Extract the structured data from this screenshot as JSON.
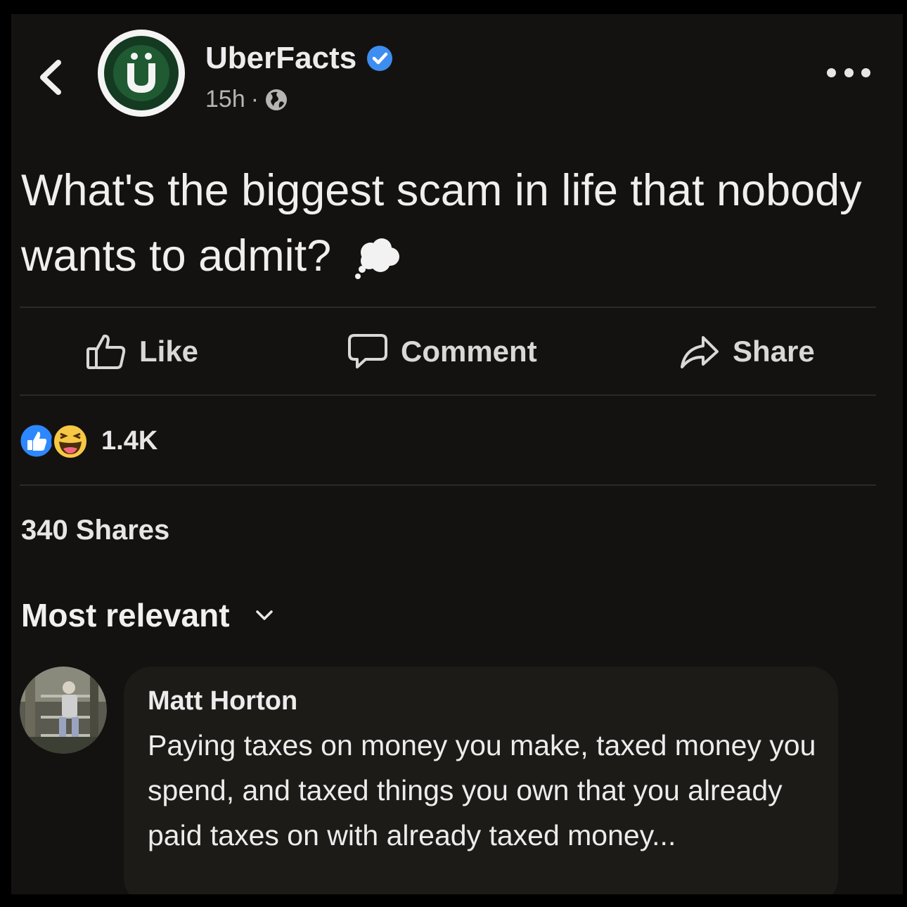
{
  "header": {
    "page_name": "UberFacts",
    "time": "15h",
    "separator": "·"
  },
  "post": {
    "text": "What's the biggest scam in life that nobody wants to admit?"
  },
  "actions": {
    "like_label": "Like",
    "comment_label": "Comment",
    "share_label": "Share"
  },
  "stats": {
    "reaction_count": "1.4K",
    "shares": "340 Shares"
  },
  "comments": {
    "sort_label": "Most relevant",
    "items": [
      {
        "author": "Matt Horton",
        "text": "Paying taxes on money you make, taxed money you spend, and taxed things you own that you already paid taxes on with already taxed money..."
      }
    ]
  },
  "colors": {
    "background": "#141210",
    "accent_blue": "#2d88ff",
    "logo_green": "#1f5a33"
  },
  "icons": [
    "back-chevron-icon",
    "verified-badge-icon",
    "globe-icon",
    "more-options-icon",
    "thought-balloon-icon",
    "like-icon",
    "comment-icon",
    "share-icon",
    "like-reaction-icon",
    "haha-reaction-icon",
    "chevron-down-icon"
  ]
}
